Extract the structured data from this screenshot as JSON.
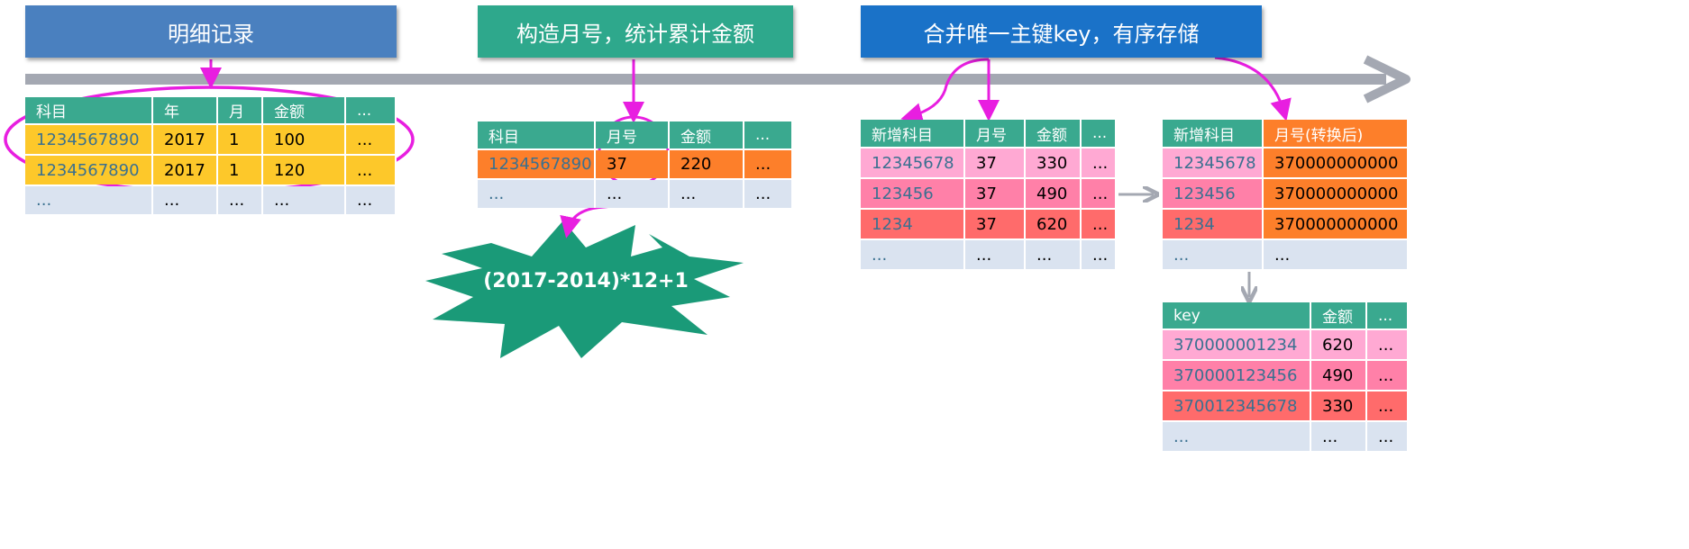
{
  "banners": {
    "detail": "明细记录",
    "month": "构造月号，统计累计金额",
    "merge": "合并唯一主键key，有序存储"
  },
  "formula": "(2017-2014)*12+1",
  "colors": {
    "header": "#3aa98f",
    "yellow": "#fdc82a",
    "orange": "#fd7f2a",
    "blank": "#dae3f0",
    "pink_light": "#ffa9d3",
    "pink": "#ff80a8",
    "red": "#ff6b6b",
    "magenta": "#e81ee0",
    "timeline": "#a4a8b2"
  },
  "tables": {
    "detail": {
      "headers": [
        "科目",
        "年",
        "月",
        "金额",
        "..."
      ],
      "rows": [
        [
          "1234567890",
          "2017",
          "1",
          "100",
          "..."
        ],
        [
          "1234567890",
          "2017",
          "1",
          "120",
          "..."
        ],
        [
          "...",
          "...",
          "...",
          "...",
          "..."
        ]
      ]
    },
    "month": {
      "headers": [
        "科目",
        "月号",
        "金额",
        "..."
      ],
      "rows": [
        [
          "1234567890",
          "37",
          "220",
          "..."
        ],
        [
          "...",
          "...",
          "...",
          "..."
        ]
      ]
    },
    "added": {
      "headers": [
        "新增科目",
        "月号",
        "金额",
        "..."
      ],
      "rows": [
        [
          "12345678",
          "37",
          "330",
          "..."
        ],
        [
          "123456",
          "37",
          "490",
          "..."
        ],
        [
          "1234",
          "37",
          "620",
          "..."
        ],
        [
          "...",
          "...",
          "...",
          "..."
        ]
      ]
    },
    "converted": {
      "headers": [
        "新增科目",
        "月号(转换后)"
      ],
      "rows": [
        [
          "12345678",
          "370000000000"
        ],
        [
          "123456",
          "370000000000"
        ],
        [
          "1234",
          "370000000000"
        ],
        [
          "...",
          "..."
        ]
      ]
    },
    "keyed": {
      "headers": [
        "key",
        "金额",
        "..."
      ],
      "rows": [
        [
          "370000001234",
          "620",
          "..."
        ],
        [
          "370000123456",
          "490",
          "..."
        ],
        [
          "370012345678",
          "330",
          "..."
        ],
        [
          "...",
          "...",
          "..."
        ]
      ]
    }
  }
}
